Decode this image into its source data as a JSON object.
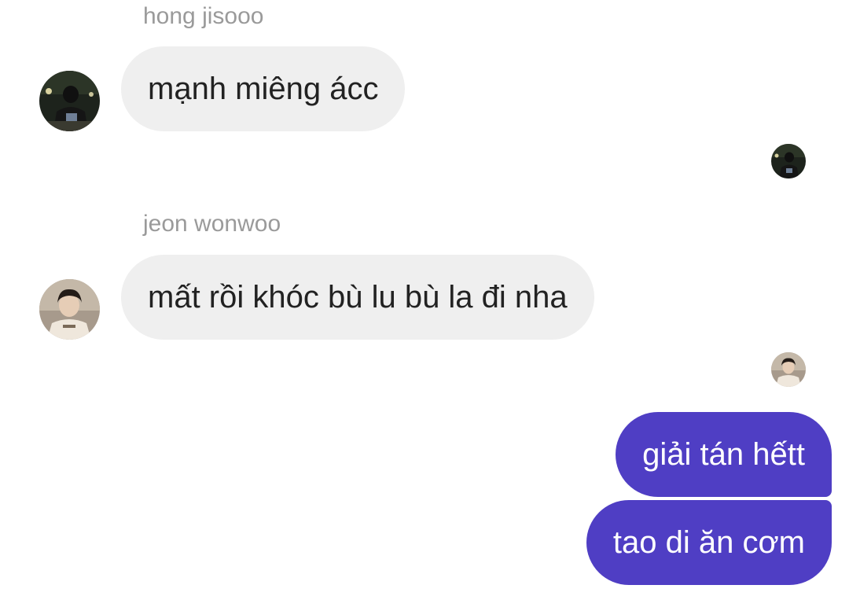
{
  "messages": [
    {
      "sender": "hong jisooo",
      "text": "mạnh miêng ácc",
      "avatar_icon": "dark-night-photo-avatar"
    },
    {
      "sender": "jeon wonwoo",
      "text": "mất rồi khóc bù lu bù la  đi nha",
      "avatar_icon": "light-portrait-avatar"
    }
  ],
  "outgoing": [
    {
      "text": "giải tán hếtt"
    },
    {
      "text": "tao di ăn cơm"
    }
  ],
  "colors": {
    "incoming_bubble": "#efefef",
    "outgoing_bubble": "#4f3ec4",
    "sender_name": "#9a9a9a",
    "text_dark": "#222222",
    "text_light": "#ffffff"
  }
}
